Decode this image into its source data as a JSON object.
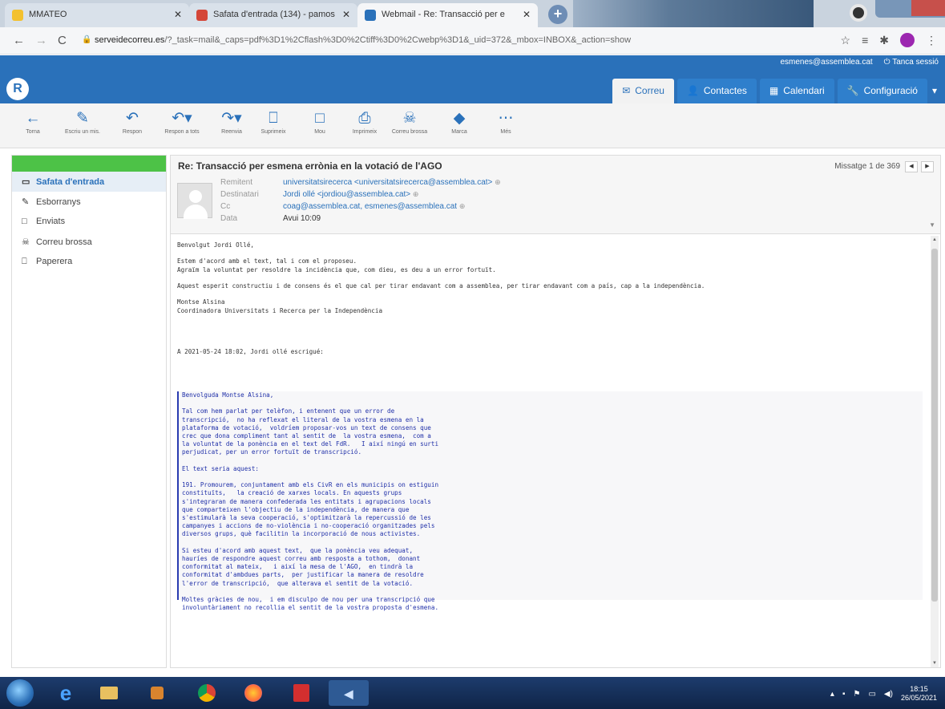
{
  "browser": {
    "tabs": [
      {
        "title": "MMATEO",
        "favicon_color": "#f3c12f"
      },
      {
        "title": "Safata d'entrada (134) - pamos",
        "favicon_color": "#d44638"
      },
      {
        "title": "Webmail - Re: Transacció per e",
        "favicon_color": "#2a71ba"
      }
    ],
    "new_tab": "+",
    "url_domain": "serveidecorreu.es",
    "url_rest": "/?_task=mail&_caps=pdf%3D1%2Cflash%3D0%2Ctiff%3D0%2Cwebp%3D1&_uid=372&_mbox=INBOX&_action=show"
  },
  "app": {
    "user_email": "esmenes@assemblea.cat",
    "logout": "Tanca sessió",
    "logo": "R",
    "tabs": [
      {
        "label": "Correu",
        "icon": "mail-icon",
        "active": true
      },
      {
        "label": "Contactes",
        "icon": "contacts-icon",
        "active": false
      },
      {
        "label": "Calendari",
        "icon": "calendar-icon",
        "active": false
      },
      {
        "label": "Configuració",
        "icon": "wrench-icon",
        "active": false
      }
    ]
  },
  "toolbar": [
    {
      "label": "Torna",
      "icon": "back-icon",
      "glyph": "←"
    },
    {
      "label": "Escriu un mis.",
      "icon": "compose-icon",
      "glyph": "✎"
    },
    {
      "label": "Respon",
      "icon": "reply-icon",
      "glyph": "↶"
    },
    {
      "label": "Respon a tots",
      "icon": "reply-all-icon",
      "glyph": "↶▾"
    },
    {
      "label": "Reenvia",
      "icon": "forward-icon",
      "glyph": "↷▾"
    },
    {
      "label": "Suprimeix",
      "icon": "trash-icon",
      "glyph": "⎕"
    },
    {
      "label": "Mou",
      "icon": "move-icon",
      "glyph": "□"
    },
    {
      "label": "Imprimeix",
      "icon": "print-icon",
      "glyph": "⎙"
    },
    {
      "label": "Correu brossa",
      "icon": "spam-icon",
      "glyph": "☠"
    },
    {
      "label": "Marca",
      "icon": "tag-icon",
      "glyph": "◆"
    },
    {
      "label": "Més",
      "icon": "more-icon",
      "glyph": "⋯"
    }
  ],
  "folders": [
    {
      "label": "Safata d'entrada",
      "icon": "inbox-icon",
      "glyph": "▭",
      "selected": true
    },
    {
      "label": "Esborranys",
      "icon": "pencil-icon",
      "glyph": "✎",
      "selected": false
    },
    {
      "label": "Enviats",
      "icon": "folder-icon",
      "glyph": "□",
      "selected": false
    },
    {
      "label": "Correu brossa",
      "icon": "spam-icon",
      "glyph": "☠",
      "selected": false
    },
    {
      "label": "Paperera",
      "icon": "trash-icon",
      "glyph": "⎕",
      "selected": false
    }
  ],
  "message": {
    "subject": "Re: Transacció per esmena errònia en la votació de l'AGO",
    "counter": "Missatge 1 de 369",
    "headers": {
      "from_label": "Remitent",
      "from_value": "universitatsirecerca <universitatsirecerca@assemblea.cat>",
      "to_label": "Destinatari",
      "to_value": "Jordi ollé <jordiou@assemblea.cat>",
      "cc_label": "Cc",
      "cc_value": "coag@assemblea.cat, esmenes@assemblea.cat",
      "date_label": "Data",
      "date_value": "Avui 10:09"
    },
    "body": "Benvolgut Jordi Ollé,\n\nEstem d'acord amb el text, tal i com el proposeu.\nAgraïm la voluntat per resoldre la incidència que, com dieu, es deu a un error fortuït.\n\nAquest esperit constructiu i de consens és el que cal per tirar endavant com a assemblea, per tirar endavant com a país, cap a la independència.\n\nMontse Alsina\nCoordinadora Universitats i Recerca per la Independència\n\n\n\n\nA 2021-05-24 18:02, Jordi ollé escrigué:",
    "quote": "Benvolguda Montse Alsina,\n\nTal com hem parlat per telèfon, i entenent que un error de\ntranscripció,  no ha reflexat el literal de la vostra esmena en la\nplataforma de votació,  voldríem proposar-vos un text de consens que\ncrec que dona compliment tant al sentit de  la vostra esmena,  com a\nla voluntat de la ponència en el text del FdR.   I així ningú en surti\nperjudicat, per un error fortuït de transcripció.\n\nEl text seria aquest:\n\n191. Promourem, conjuntament amb els CivR en els municipis on estiguin\nconstituïts,   la creació de xarxes locals. En aquests grups\ns'integraran de manera confederada les entitats i agrupacions locals\nque comparteixen l'objectiu de la independència, de manera que\ns'estimularà la seva cooperació, s'optimitzarà la repercussió de les\ncampanyes i accions de no-violència i no-cooperació organitzades pels\ndiversos grups, què facilitin la incorporació de nous activistes.\n\nSi esteu d'acord amb aquest text,  que la ponència veu adequat,\nhauríes de respondre aquest correu amb resposta a tothom,  donant\nconformitat al mateix,   i així la mesa de l'AGO,  en tindrà la\nconformitat d'ambdues parts,  per justificar la manera de resoldre\nl'error de transcripció,  que alterava el sentit de la votació.\n\nMoltes gràcies de nou,  i em disculpo de nou per una transcripció que\ninvoluntàriament no recollia el sentit de la vostra proposta d'esmena."
  },
  "taskbar": {
    "clock_time": "18:15",
    "clock_date": "26/05/2021"
  },
  "colors": {
    "brand": "#2a71ba",
    "sidebar_accent": "#4dc247",
    "quote_text": "#1f2fa8"
  }
}
